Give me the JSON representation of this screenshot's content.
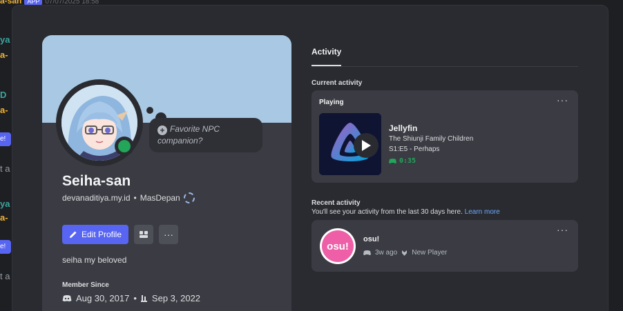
{
  "background_chat": {
    "username": "a-san",
    "app_badge": "APP",
    "timestamp": "07/07/2025 18:58",
    "fragments": [
      "ya D",
      "a-",
      "D",
      "a-",
      "e!",
      "t a",
      "ya D",
      "a-",
      "e!",
      "t a"
    ]
  },
  "profile": {
    "custom_status": "Favorite NPC companion?",
    "display_name": "Seiha-san",
    "username": "devanaditiya.my.id",
    "server_tag": "MasDepan",
    "edit_button": "Edit Profile",
    "more_label": "···",
    "bio": "seiha my beloved",
    "member_since_label": "Member Since",
    "discord_date": "Aug 30, 2017",
    "server_date": "Sep 3, 2022",
    "status": "online",
    "colors": {
      "banner": "#a9c8e3",
      "online": "#23a55a",
      "primary": "#5865f2"
    }
  },
  "activity": {
    "tab_label": "Activity",
    "current_label": "Current activity",
    "playing_label": "Playing",
    "card_more": "···",
    "app_name": "Jellyfin",
    "series": "The Shiunji Family Children",
    "episode": "S1:E5 - Perhaps",
    "elapsed": "0:35",
    "recent_label": "Recent activity",
    "recent_sub": "You'll see your activity from the last 30 days here.",
    "learn_more": "Learn more",
    "recent": {
      "logo_text": "osu!",
      "game": "osu!",
      "when": "3w ago",
      "tag": "New Player",
      "more": "···"
    }
  }
}
